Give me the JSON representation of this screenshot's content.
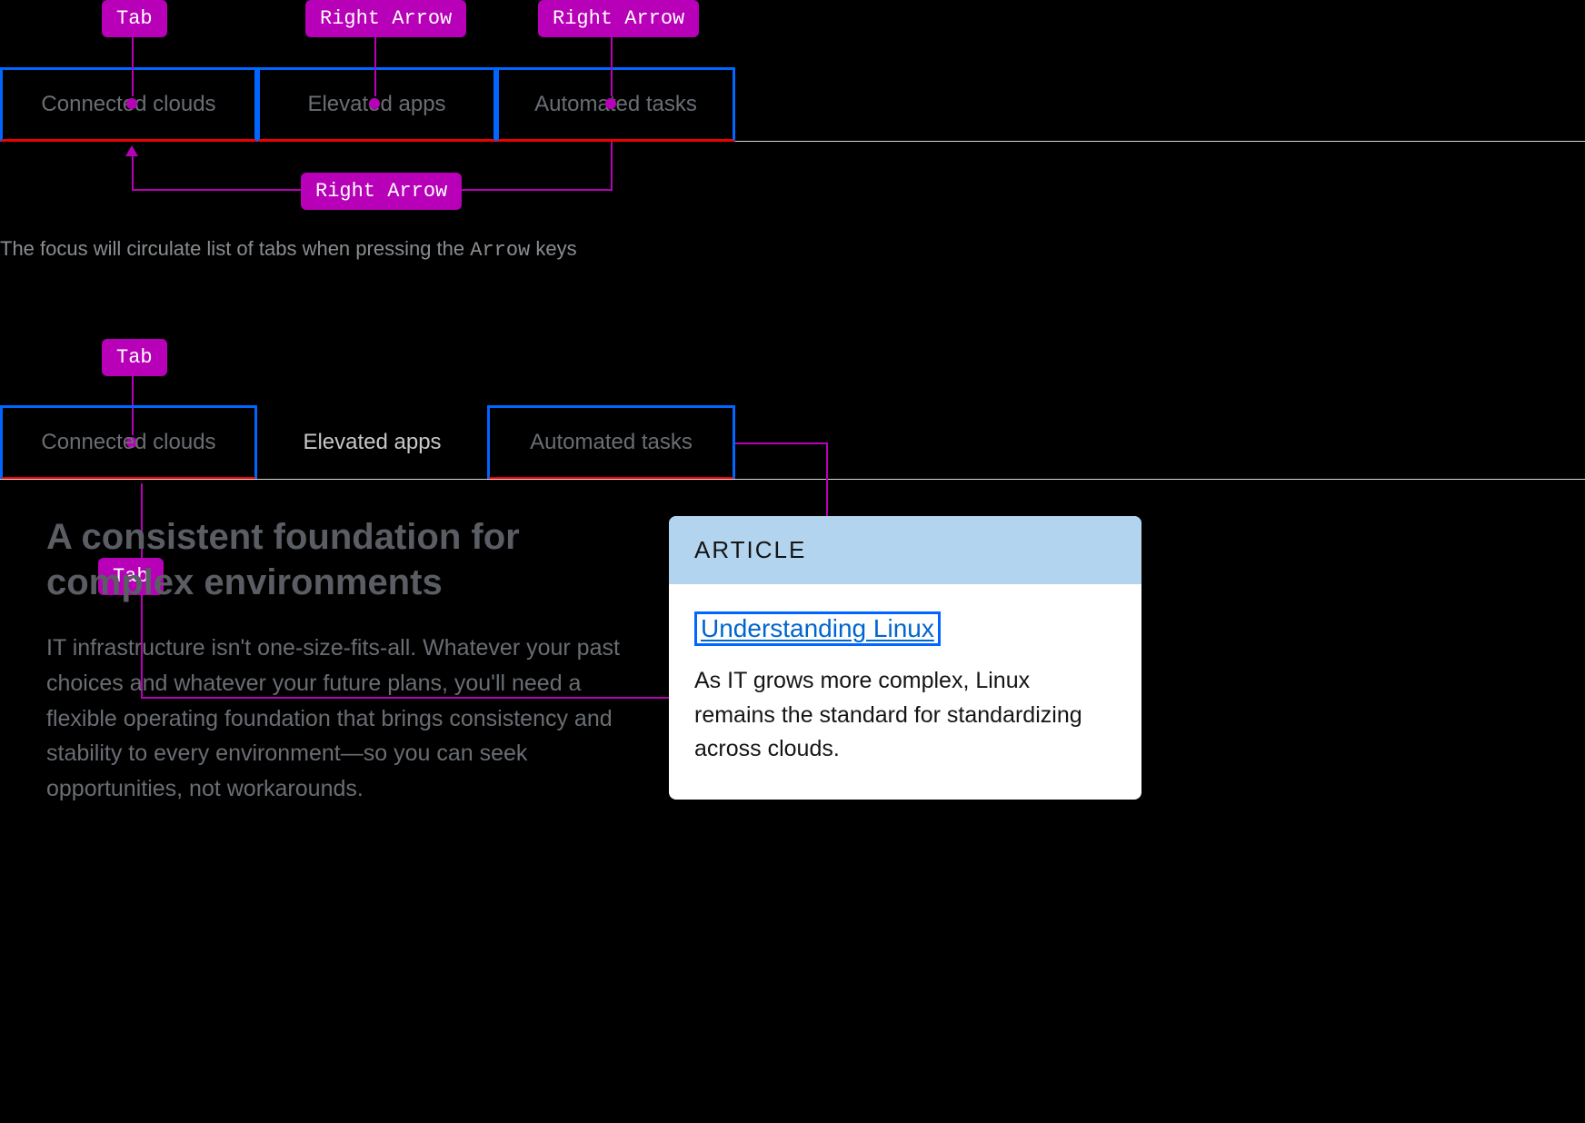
{
  "labels": {
    "tab": "Tab",
    "right_arrow": "Right Arrow"
  },
  "example1": {
    "tabs": [
      "Connected clouds",
      "Elevated apps",
      "Automated tasks"
    ]
  },
  "caption": {
    "pre": "The focus will circulate list of tabs when pressing the ",
    "key": "Arrow",
    "post": " keys"
  },
  "example2": {
    "tabs": [
      "Connected clouds",
      "Elevated apps",
      "Automated tasks"
    ]
  },
  "content": {
    "heading": "A consistent foundation for complex environments",
    "body": "IT infrastructure isn't one-size-fits-all. Whatever your past choices and whatever your future plans, you'll need a flexible operating foundation that brings consistency and stability to every environment—so you can seek opportunities, not workarounds."
  },
  "card": {
    "eyebrow": "ARTICLE",
    "link": "Understanding Linux",
    "desc": "As IT grows more complex, Linux remains the standard for standardizing across clouds."
  }
}
